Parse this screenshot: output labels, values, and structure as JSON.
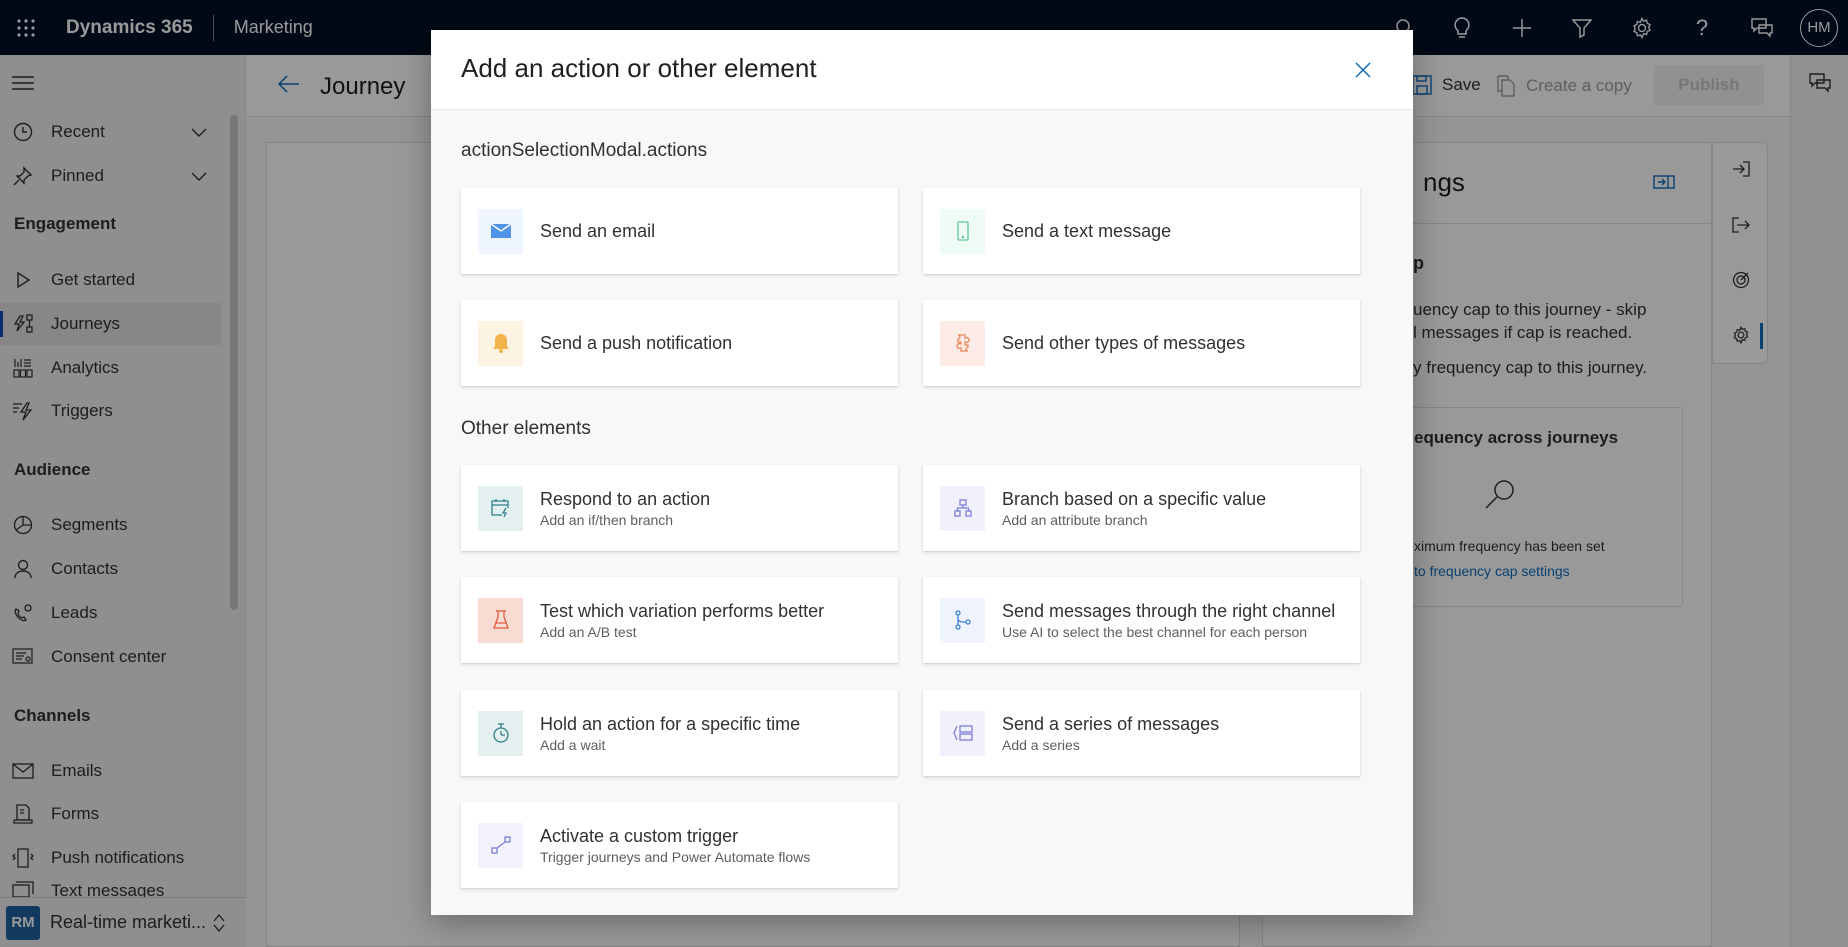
{
  "topbar": {
    "brand": "Dynamics 365",
    "app_name": "Marketing",
    "icons": [
      "search-icon",
      "lightbulb-icon",
      "plus-icon",
      "filter-icon",
      "gear-icon",
      "help-icon",
      "chat-icon"
    ],
    "avatar_initials": "HM"
  },
  "sidebar": {
    "top_items": [
      {
        "label": "Recent",
        "icon": "clock-icon"
      },
      {
        "label": "Pinned",
        "icon": "pin-icon"
      }
    ],
    "sections": [
      {
        "title": "Engagement",
        "items": [
          {
            "label": "Get started",
            "icon": "play-icon"
          },
          {
            "label": "Journeys",
            "icon": "journey-icon",
            "active": true
          },
          {
            "label": "Analytics",
            "icon": "analytics-icon"
          },
          {
            "label": "Triggers",
            "icon": "trigger-icon"
          }
        ]
      },
      {
        "title": "Audience",
        "items": [
          {
            "label": "Segments",
            "icon": "segments-icon"
          },
          {
            "label": "Contacts",
            "icon": "person-icon"
          },
          {
            "label": "Leads",
            "icon": "leads-icon"
          },
          {
            "label": "Consent center",
            "icon": "consent-icon"
          }
        ]
      },
      {
        "title": "Channels",
        "items": [
          {
            "label": "Emails",
            "icon": "mail-icon"
          },
          {
            "label": "Forms",
            "icon": "form-icon"
          },
          {
            "label": "Push notifications",
            "icon": "push-icon"
          },
          {
            "label": "Text messages",
            "icon": "text-message-icon"
          }
        ]
      }
    ],
    "footer": {
      "badge": "RM",
      "label": "Real-time marketi..."
    }
  },
  "page": {
    "title": "Journey",
    "save_label": "Save",
    "copy_label": "Create a copy",
    "publish_label": "Publish"
  },
  "settings_panel": {
    "title": "ngs",
    "subtitle": "p",
    "desc": "uency cap to this journey - skip\nl messages if cap is reached.",
    "desc2": "y frequency cap to this journey.",
    "freq_title": "equency across journeys",
    "freq_empty": "ximum frequency has been set",
    "freq_link": "to frequency cap settings"
  },
  "modal": {
    "title": "Add an action or other element",
    "actions_label": "actionSelectionModal.actions",
    "actions": [
      {
        "title": "Send an email",
        "icon": "mail-icon",
        "color": "#4f94e6",
        "bg": "#eff6ff"
      },
      {
        "title": "Send a text message",
        "icon": "phone-icon",
        "color": "#5ec796",
        "bg": "#eefcf5"
      },
      {
        "title": "Send a push notification",
        "icon": "bell-icon",
        "color": "#f4b24a",
        "bg": "#fdf3e3"
      },
      {
        "title": "Send other types of messages",
        "icon": "puzzle-icon",
        "color": "#e88a5e",
        "bg": "#fcebe6"
      }
    ],
    "other_label": "Other elements",
    "others": [
      {
        "title": "Respond to an action",
        "subtitle": "Add an if/then branch",
        "icon": "calendar-bolt-icon",
        "color": "#2f7f86",
        "bg": "#e4eff0"
      },
      {
        "title": "Branch based on a specific value",
        "subtitle": "Add an attribute branch",
        "icon": "hierarchy-icon",
        "color": "#7b7fd3",
        "bg": "#f0f1fc"
      },
      {
        "title": "Test which variation performs better",
        "subtitle": "Add an A/B test",
        "icon": "flask-icon",
        "color": "#e05a3a",
        "bg": "#f8dcd4"
      },
      {
        "title": "Send messages through the right channel",
        "subtitle": "Use AI to select the best channel for each person",
        "icon": "branch-icon",
        "color": "#3f7fd6",
        "bg": "#eef3fd"
      },
      {
        "title": "Hold an action for a specific time",
        "subtitle": "Add a wait",
        "icon": "timer-icon",
        "color": "#2f7f86",
        "bg": "#e4eff0"
      },
      {
        "title": "Send a series of messages",
        "subtitle": "Add a series",
        "icon": "series-icon",
        "color": "#7b7fd3",
        "bg": "#f0f1fc"
      },
      {
        "title": "Activate a custom trigger",
        "subtitle": "Trigger journeys and Power Automate flows",
        "icon": "custom-trigger-icon",
        "color": "#7b7fd3",
        "bg": "#f2f2fc"
      }
    ]
  }
}
